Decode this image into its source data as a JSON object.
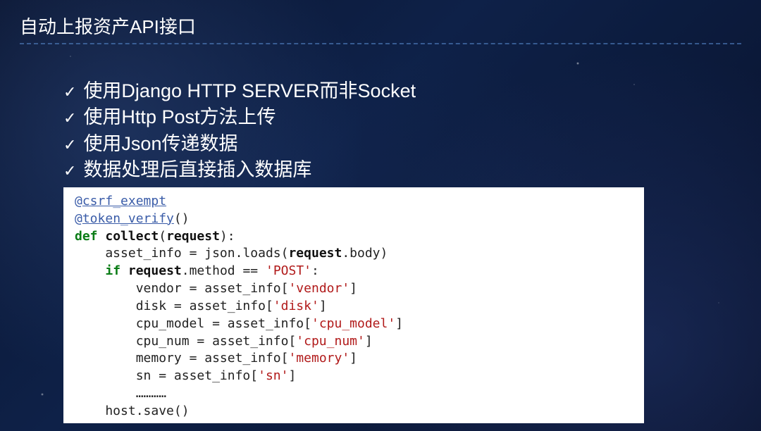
{
  "title": "自动上报资产API接口",
  "bullets": [
    "使用Django HTTP SERVER而非Socket",
    "使用Http Post方法上传",
    "使用Json传递数据",
    "数据处理后直接插入数据库"
  ],
  "code": {
    "decorator1_at": "@",
    "decorator1_name": "csrf_exempt",
    "decorator2_at": "@",
    "decorator2_name": "token_verify",
    "decorator2_parens": "()",
    "kw_def": "def",
    "fn_name": " collect",
    "fn_sig_open": "(",
    "fn_param": "request",
    "fn_sig_close": "):",
    "l1_a": "    asset_info ",
    "l1_b": "=",
    "l1_c": " json",
    "l1_d": ".",
    "l1_e": "loads",
    "l1_f": "(",
    "l1_g": "request",
    "l1_h": ".",
    "l1_i": "body",
    "l1_j": ")",
    "l2_a": "    ",
    "l2_b": "if",
    "l2_c": " request",
    "l2_d": ".",
    "l2_e": "method ",
    "l2_f": "==",
    "l2_g": " ",
    "l2_h": "'POST'",
    "l2_i": ":",
    "l3_a": "        vendor ",
    "l3_b": "=",
    "l3_c": " asset_info",
    "l3_d": "[",
    "l3_e": "'vendor'",
    "l3_f": "]",
    "l4_a": "        disk ",
    "l4_b": "=",
    "l4_c": " asset_info",
    "l4_d": "[",
    "l4_e": "'disk'",
    "l4_f": "]",
    "l5_a": "        cpu_model ",
    "l5_b": "=",
    "l5_c": " asset_info",
    "l5_d": "[",
    "l5_e": "'cpu_model'",
    "l5_f": "]",
    "l6_a": "        cpu_num ",
    "l6_b": "=",
    "l6_c": " asset_info",
    "l6_d": "[",
    "l6_e": "'cpu_num'",
    "l6_f": "]",
    "l7_a": "        memory ",
    "l7_b": "=",
    "l7_c": " asset_info",
    "l7_d": "[",
    "l7_e": "'memory'",
    "l7_f": "]",
    "l8_a": "        sn ",
    "l8_b": "=",
    "l8_c": " asset_info",
    "l8_d": "[",
    "l8_e": "'sn'",
    "l8_f": "]",
    "l9": "        …………",
    "l10_a": "    host",
    "l10_b": ".",
    "l10_c": "save",
    "l10_d": "()"
  }
}
